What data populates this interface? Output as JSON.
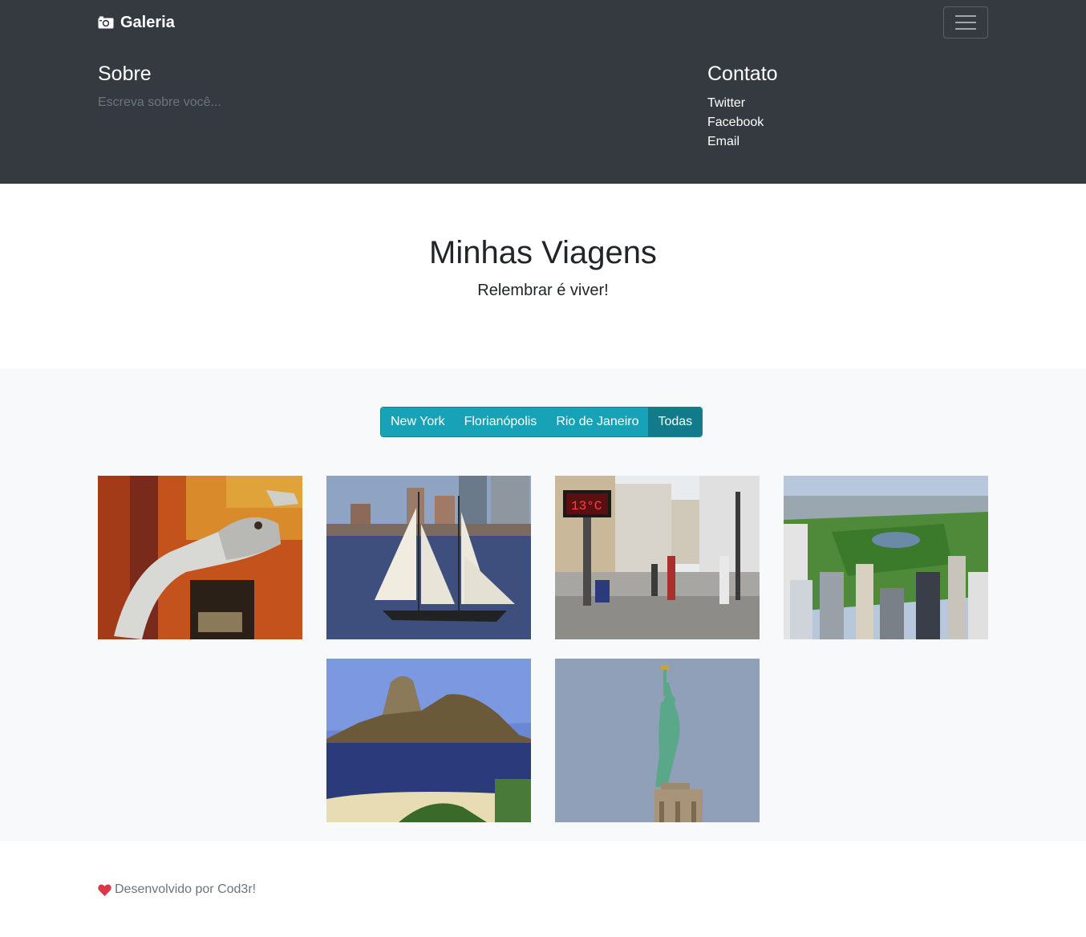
{
  "navbar": {
    "brand": "Galeria",
    "brand_icon": "camera-icon",
    "toggler_icon": "hamburger-menu-icon"
  },
  "about": {
    "title": "Sobre",
    "text": "Escreva sobre você..."
  },
  "contact": {
    "title": "Contato",
    "links": [
      "Twitter",
      "Facebook",
      "Email"
    ]
  },
  "hero": {
    "title": "Minhas Viagens",
    "subtitle": "Relembrar é viver!"
  },
  "filters": {
    "buttons": [
      "New York",
      "Florianópolis",
      "Rio de Janeiro",
      "Todas"
    ],
    "active": "Todas"
  },
  "gallery": {
    "photos": [
      {
        "subject": "dinosaur skeleton museum"
      },
      {
        "subject": "sailboat on river with skyline"
      },
      {
        "subject": "pedestrian street with thermometer"
      },
      {
        "subject": "aerial view of central park"
      },
      {
        "subject": "sugarloaf mountain bay"
      },
      {
        "subject": "statue of liberty"
      }
    ]
  },
  "footer": {
    "icon": "heart-icon",
    "text": "Desenvolvido por Cod3r!"
  },
  "colors": {
    "navbar_bg": "#343a40",
    "accent": "#17a2b8",
    "accent_active": "#117a8b",
    "heart": "#dc3545"
  }
}
